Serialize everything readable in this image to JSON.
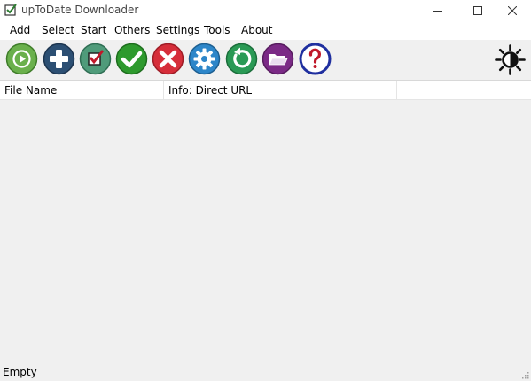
{
  "window": {
    "title": "upToDate Downloader",
    "icons": [
      "app-checklist-icon",
      "minimize-icon",
      "maximize-icon",
      "close-icon"
    ]
  },
  "menu": {
    "items": [
      {
        "label": "Add"
      },
      {
        "label": "Select"
      },
      {
        "label": "Start"
      },
      {
        "label": "Others"
      },
      {
        "label": "Settings"
      },
      {
        "label": "Tools"
      },
      {
        "label": "About"
      }
    ]
  },
  "toolbar": {
    "buttons": [
      {
        "icon": "play-icon",
        "color": "#6ab04c"
      },
      {
        "icon": "plus-icon",
        "color": "#2c4f73"
      },
      {
        "icon": "checkbox-icon",
        "color": "#4f9b7a"
      },
      {
        "icon": "checkmark-icon",
        "color": "#2e9a2e"
      },
      {
        "icon": "cross-icon",
        "color": "#d62e3a"
      },
      {
        "icon": "gear-icon",
        "color": "#2d86c9"
      },
      {
        "icon": "refresh-icon",
        "color": "#2a9a55"
      },
      {
        "icon": "folder-icon",
        "color": "#7b2a86"
      },
      {
        "icon": "help-icon",
        "color": "#1f2f9f"
      }
    ],
    "theme_icon": "brightness-icon"
  },
  "table": {
    "columns": [
      "File Name",
      "Info: Direct URL",
      ""
    ]
  },
  "status": {
    "text": "Empty"
  }
}
